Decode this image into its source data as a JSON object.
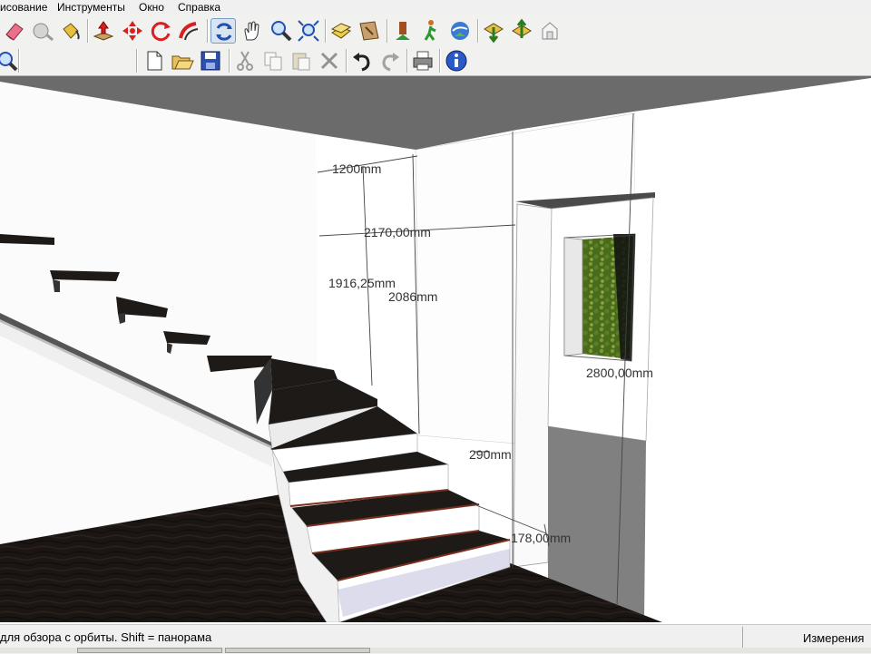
{
  "menu": {
    "items": [
      {
        "label": "исование"
      },
      {
        "label": "Инструменты"
      },
      {
        "label": "Окно"
      },
      {
        "label": "Справка"
      }
    ]
  },
  "toolbar_row1": [
    {
      "name": "eraser-icon"
    },
    {
      "name": "tape-measure-icon"
    },
    {
      "name": "paint-bucket-icon"
    },
    {
      "name": "push-pull-icon"
    },
    {
      "name": "move-icon"
    },
    {
      "name": "rotate-icon"
    },
    {
      "name": "follow-me-icon"
    },
    {
      "name": "orbit-icon"
    },
    {
      "name": "pan-hand-icon"
    },
    {
      "name": "zoom-icon"
    },
    {
      "name": "zoom-extents-icon"
    },
    {
      "name": "components-icon"
    },
    {
      "name": "section-plane-icon"
    },
    {
      "name": "position-camera-icon"
    },
    {
      "name": "walk-icon"
    },
    {
      "name": "google-earth-icon"
    },
    {
      "name": "get-models-icon"
    },
    {
      "name": "share-model-icon"
    },
    {
      "name": "building-maker-icon"
    }
  ],
  "toolbar_row2": [
    {
      "name": "zoom-window-icon"
    },
    {
      "name": "new-file-icon"
    },
    {
      "name": "open-file-icon"
    },
    {
      "name": "save-icon"
    },
    {
      "name": "cut-icon"
    },
    {
      "name": "copy-icon"
    },
    {
      "name": "paste-icon"
    },
    {
      "name": "delete-icon"
    },
    {
      "name": "undo-icon"
    },
    {
      "name": "redo-icon"
    },
    {
      "name": "print-icon"
    },
    {
      "name": "model-info-icon"
    }
  ],
  "viewport": {
    "dimensions": [
      {
        "label": "1200mm"
      },
      {
        "label": "2170,00mm"
      },
      {
        "label": "1916,25mm"
      },
      {
        "label": "2086mm"
      },
      {
        "label": "2800,00mm"
      },
      {
        "label": "290mm"
      },
      {
        "label": "178,00mm"
      }
    ]
  },
  "status": {
    "hint": "для обзора с орбиты.  Shift = панорама",
    "measurements_label": "Измерения",
    "measurements_value": ""
  }
}
